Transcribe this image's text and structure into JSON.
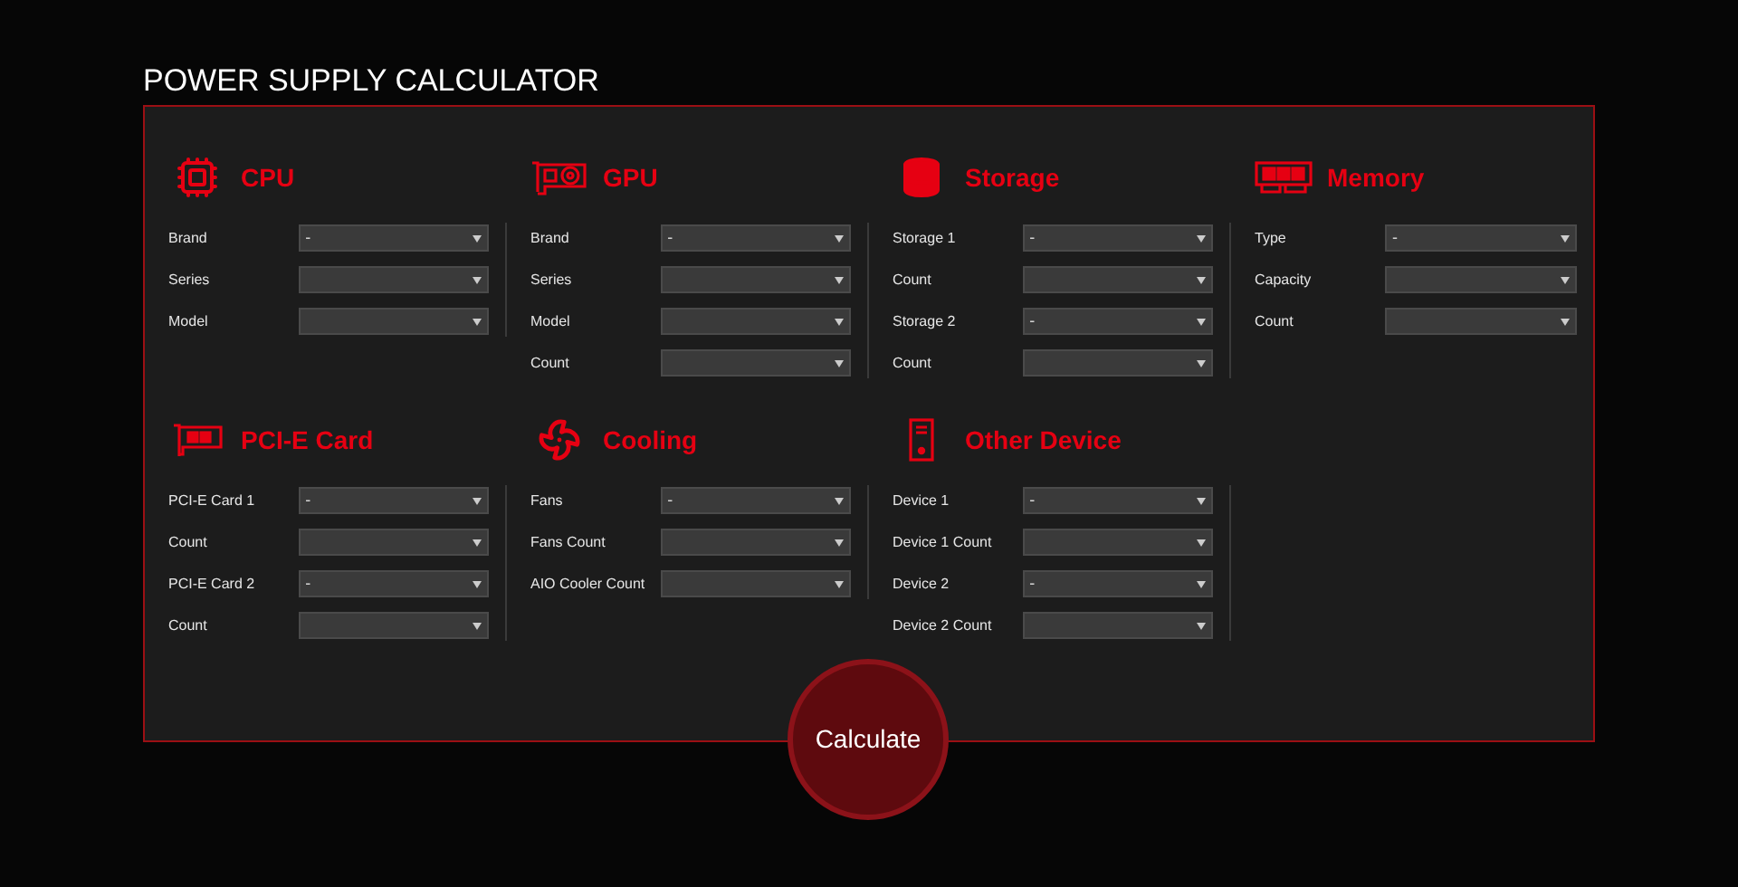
{
  "title": "POWER SUPPLY CALCULATOR",
  "sections": [
    {
      "title": "CPU",
      "kind": "cpu",
      "fields": [
        {
          "label": "Brand",
          "value": "-"
        },
        {
          "label": "Series"
        },
        {
          "label": "Model"
        }
      ]
    },
    {
      "title": "GPU",
      "kind": "gpu",
      "fields": [
        {
          "label": "Brand",
          "value": "-"
        },
        {
          "label": "Series"
        },
        {
          "label": "Model"
        },
        {
          "label": "Count"
        }
      ]
    },
    {
      "title": "Storage",
      "kind": "storage",
      "fields": [
        {
          "label": "Storage 1",
          "value": "-"
        },
        {
          "label": "Count"
        },
        {
          "label": "Storage 2",
          "value": "-"
        },
        {
          "label": "Count"
        }
      ]
    },
    {
      "title": "Memory",
      "kind": "memory",
      "fields": [
        {
          "label": "Type",
          "value": "-"
        },
        {
          "label": "Capacity"
        },
        {
          "label": "Count"
        }
      ]
    },
    {
      "title": "PCI-E Card",
      "kind": "pcie",
      "fields": [
        {
          "label": "PCI-E Card 1",
          "value": "-"
        },
        {
          "label": "Count"
        },
        {
          "label": "PCI-E Card 2",
          "value": "-"
        },
        {
          "label": "Count"
        }
      ]
    },
    {
      "title": "Cooling",
      "kind": "cooling",
      "fields": [
        {
          "label": "Fans",
          "value": "-"
        },
        {
          "label": "Fans Count"
        },
        {
          "label": "AIO Cooler Count"
        }
      ]
    },
    {
      "title": "Other Device",
      "kind": "device",
      "fields": [
        {
          "label": "Device 1",
          "value": "-"
        },
        {
          "label": "Device 1 Count"
        },
        {
          "label": "Device 2",
          "value": "-"
        },
        {
          "label": "Device 2 Count"
        }
      ]
    }
  ],
  "button": "Calculate"
}
